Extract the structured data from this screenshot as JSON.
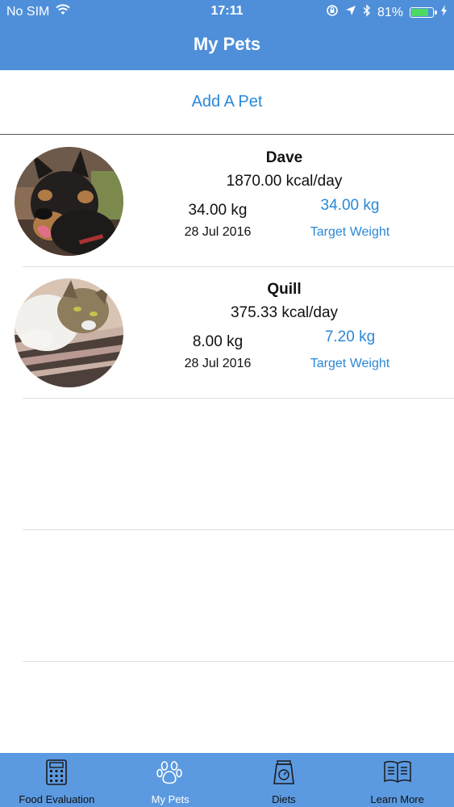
{
  "status_bar": {
    "carrier": "No SIM",
    "time": "17:11",
    "battery_percent": "81%",
    "battery_level": 0.81,
    "icons": [
      "wifi-icon",
      "orientation-lock-icon",
      "location-arrow-icon",
      "bluetooth-icon",
      "battery-icon",
      "charging-bolt-icon"
    ]
  },
  "nav": {
    "title": "My Pets"
  },
  "add_pet": {
    "label": "Add A Pet"
  },
  "pets": [
    {
      "name": "Dave",
      "kcal": "1870.00 kcal/day",
      "weight": "34.00 kg",
      "date": "28 Jul 2016",
      "target_weight": "34.00 kg",
      "target_label": "Target Weight",
      "photo": "dog-photo"
    },
    {
      "name": "Quill",
      "kcal": "375.33 kcal/day",
      "weight": "8.00 kg",
      "date": "28 Jul 2016",
      "target_weight": "7.20 kg",
      "target_label": "Target Weight",
      "photo": "cat-photo"
    }
  ],
  "tabs": [
    {
      "label": "Food Evaluation",
      "icon": "calculator-icon",
      "active": false
    },
    {
      "label": "My Pets",
      "icon": "paw-icon",
      "active": true
    },
    {
      "label": "Diets",
      "icon": "food-bag-icon",
      "active": false
    },
    {
      "label": "Learn More",
      "icon": "book-icon",
      "active": false
    }
  ],
  "colors": {
    "header": "#4f8fd9",
    "tabbar": "#5b9ae0",
    "link": "#2a88d8",
    "battery": "#4cd964"
  }
}
